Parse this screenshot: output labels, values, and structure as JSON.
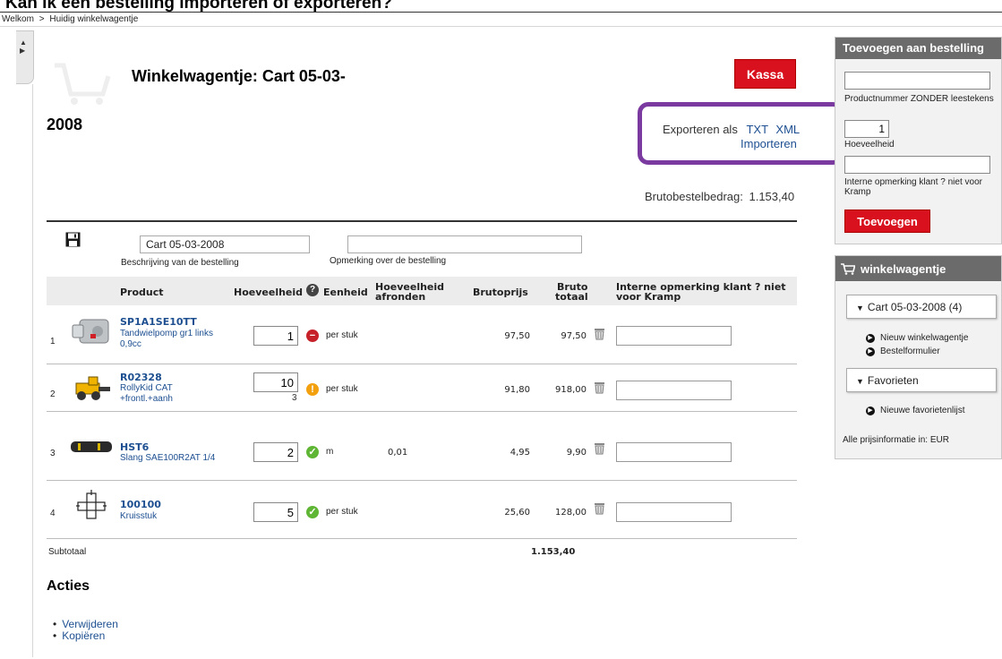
{
  "doc_heading": "Kan ik een bestelling importeren of exporteren?",
  "breadcrumb": {
    "home": "Welkom",
    "separator": ">",
    "current": "Huidig winkelwagentje"
  },
  "color_bar": [
    "#1d8a3a",
    "#8dc63f",
    "#f5e35b",
    "#3a3da0",
    "#d11f26",
    "#ef7f2a"
  ],
  "page": {
    "title": "Winkelwagentje: Cart 05-03-",
    "title_year": "2008",
    "kassa_label": "Kassa",
    "export_label": "Exporteren als",
    "export_txt": "TXT",
    "export_xml": "XML",
    "import_label": "Importeren",
    "bruto_label": "Brutobestelbedrag:",
    "bruto_value": "1.153,40"
  },
  "order": {
    "description_value": "Cart 05-03-2008",
    "description_label": "Beschrijving van de bestelling",
    "remark_value": "",
    "remark_label": "Opmerking over de bestelling"
  },
  "table": {
    "headers": {
      "product": "Product",
      "quantity": "Hoeveelheid",
      "unit": "Eenheid",
      "round_1": "Hoeveelheid",
      "round_2": "afronden",
      "price": "Brutoprijs",
      "total_1": "Bruto",
      "total_2": "totaal",
      "note_1": "Interne opmerking klant ? niet",
      "note_2": "voor Kramp"
    },
    "rows": [
      {
        "num": "1",
        "code": "SP1A1SE10TT",
        "desc": "Tandwielpomp gr1 links 0,9cc",
        "qty": "1",
        "qty_sub": "",
        "status": "red",
        "status_glyph": "−",
        "unit": "per stuk",
        "round": "",
        "price": "97,50",
        "total": "97,50",
        "thumb": "pump"
      },
      {
        "num": "2",
        "code": "R02328",
        "desc": "RollyKid CAT +frontl.+aanh",
        "qty": "10",
        "qty_sub": "3",
        "status": "orange",
        "status_glyph": "!",
        "unit": "per stuk",
        "round": "",
        "price": "91,80",
        "total": "918,00",
        "thumb": "toy"
      },
      {
        "num": "3",
        "code": "HST6",
        "desc": "Slang SAE100R2AT 1/4",
        "qty": "2",
        "qty_sub": "",
        "status": "green",
        "status_glyph": "✓",
        "unit": "m",
        "round": "0,01",
        "price": "4,95",
        "total": "9,90",
        "thumb": "hose"
      },
      {
        "num": "4",
        "code": "100100",
        "desc": "Kruisstuk",
        "qty": "5",
        "qty_sub": "",
        "status": "green",
        "status_glyph": "✓",
        "unit": "per stuk",
        "round": "",
        "price": "25,60",
        "total": "128,00",
        "thumb": "cross"
      }
    ],
    "subtotal_label": "Subtotaal",
    "subtotal_value": "1.153,40"
  },
  "acties": {
    "title": "Acties",
    "items": [
      "Verwijderen",
      "Kopiëren"
    ]
  },
  "add_panel": {
    "title": "Toevoegen aan bestelling",
    "product_value": "",
    "product_label": "Productnummer ZONDER leestekens",
    "qty_value": "1",
    "qty_label": "Hoeveelheid",
    "note_value": "",
    "note_label": "Interne opmerking klant ? niet voor Kramp",
    "button": "Toevoegen"
  },
  "cart_panel": {
    "title": "winkelwagentje",
    "cart_dropdown": "Cart 05-03-2008 (4)",
    "new_cart": "Nieuw winkelwagentje",
    "order_form": "Bestelformulier",
    "favorites_dropdown": "Favorieten",
    "new_favorites": "Nieuwe favorietenlijst",
    "price_note": "Alle prijsinformatie in: EUR"
  },
  "icons": {
    "save": "floppy-disk-icon",
    "trash": "trash-icon",
    "help": "help-icon",
    "cart": "cart-icon"
  },
  "colors": {
    "accent_red": "#d9101d",
    "link_blue": "#1d4f91",
    "highlight_purple": "#7a3aa0",
    "panel_header": "#6b6b6b"
  }
}
